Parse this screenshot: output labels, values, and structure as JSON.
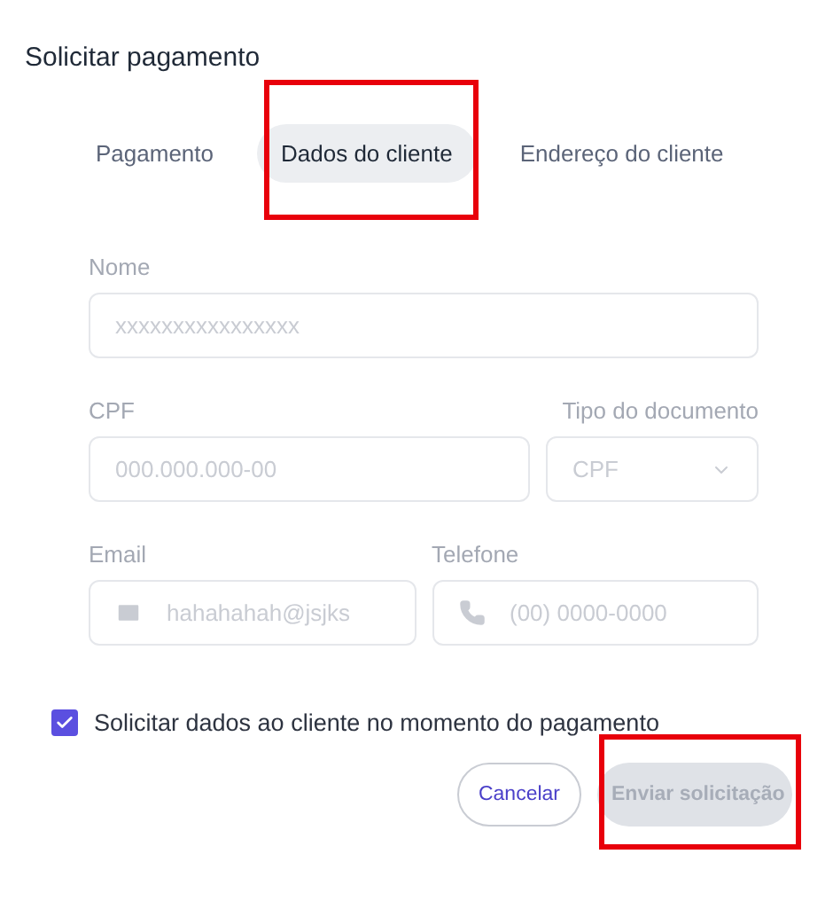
{
  "dialog": {
    "title": "Solicitar pagamento"
  },
  "tabs": [
    {
      "label": "Pagamento",
      "selected": false,
      "highlighted": false
    },
    {
      "label": "Dados do cliente",
      "selected": true,
      "highlighted": true
    },
    {
      "label": "Endereço do cliente",
      "selected": false,
      "highlighted": false
    }
  ],
  "field_rows": [
    [
      {
        "label": "Nome",
        "placeholder": "xxxxxxxxxxxxxxxx",
        "kind": "text",
        "disabled": true
      }
    ],
    [
      {
        "label": "CPF",
        "placeholder": "000.000.000-00",
        "kind": "text",
        "disabled": true
      },
      {
        "label": "Tipo do documento",
        "value": "CPF",
        "kind": "select",
        "disabled": true
      }
    ],
    [
      {
        "label": "Email",
        "placeholder": "hahahahah@jsjks",
        "kind": "email",
        "disabled": true
      },
      {
        "label": "Telefone",
        "placeholder": "(00) 0000-0000",
        "kind": "phone",
        "disabled": true
      }
    ]
  ],
  "checkbox": {
    "label": "Solicitar dados ao cliente no momento do pagamento",
    "checked": true
  },
  "buttons": [
    {
      "label": "Cancelar",
      "kind": "secondary",
      "disabled": false,
      "highlighted": false
    },
    {
      "label": "Enviar solicitação",
      "kind": "primary",
      "disabled": true,
      "highlighted": true
    }
  ]
}
